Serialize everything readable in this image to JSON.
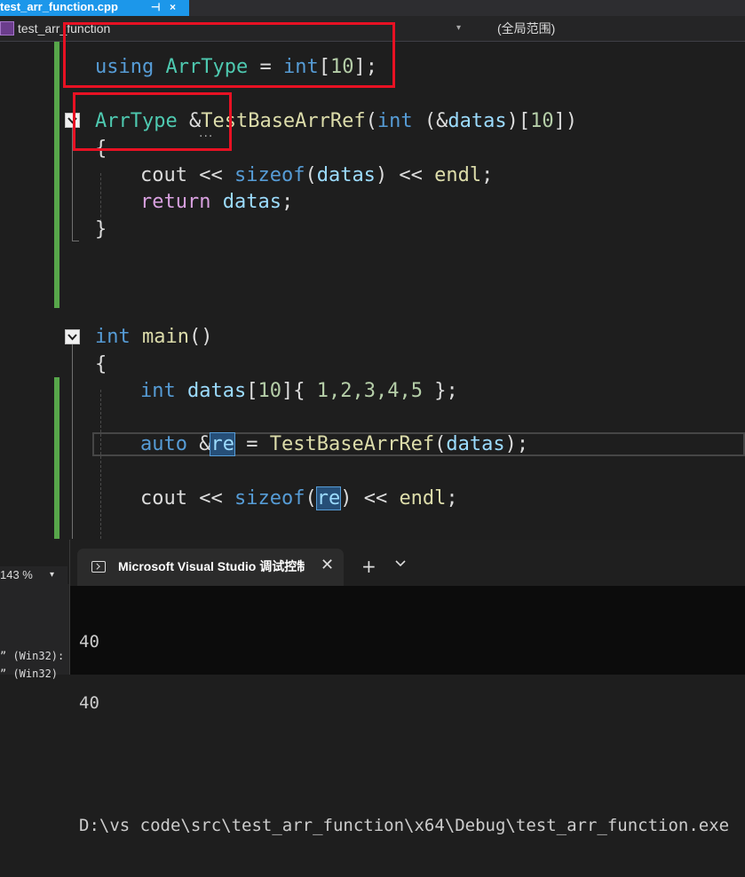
{
  "tab": {
    "filename": "test_arr_function.cpp",
    "pin_icon": "⊣",
    "close_icon": "×"
  },
  "navbar": {
    "scope": "test_arr_function",
    "global_scope": "(全局范围)",
    "dropdown_icon": "▾"
  },
  "code": {
    "line1": {
      "kw": "using",
      "type": "ArrType",
      "eq": " = ",
      "int": "int",
      "br": "[",
      "num": "10",
      "end": "];"
    },
    "line2": {
      "type": "ArrType",
      "amp": " &",
      "fn": "TestBaseArrRef",
      "p1": "(",
      "int": "int",
      "p2": " (&",
      "param": "datas",
      "p3": ")[",
      "num": "10",
      "p4": "])"
    },
    "brace_open": "{",
    "line3": {
      "id": "cout",
      "op1": " << ",
      "fn": "sizeof",
      "p1": "(",
      "param": "datas",
      "p2": ")",
      "op2": " << ",
      "endl": "endl",
      "semi": ";"
    },
    "line4": {
      "kw": "return",
      "sp": " ",
      "param": "datas",
      "semi": ";"
    },
    "brace_close": "}",
    "line5": {
      "int": "int",
      "sp": " ",
      "fn": "main",
      "paren": "()"
    },
    "brace_open2": "{",
    "line6": {
      "int": "int",
      "sp": " ",
      "var": "datas",
      "br": "[",
      "num": "10",
      "rest1": "]{ ",
      "nums": "1,2,3,4,5",
      "rest2": " };"
    },
    "line7": {
      "kw": "auto",
      "amp": " &",
      "var": "re",
      "eq": " = ",
      "fn": "TestBaseArrRef",
      "p1": "(",
      "arg": "datas",
      "p2": ");"
    },
    "line8": {
      "id": "cout",
      "op1": " << ",
      "fn": "sizeof",
      "p1": "(",
      "var": "re",
      "p2": ")",
      "op2": " << ",
      "endl": "endl",
      "semi": ";"
    }
  },
  "status": {
    "zoom": "143 %",
    "zoom_dropdown": "▾",
    "output1": "” (Win32):",
    "output2": "” (Win32)"
  },
  "terminal": {
    "title": "Microsoft Visual Studio 调试控制台",
    "close": "✕",
    "plus": "+",
    "lines": [
      "40",
      "40",
      "",
      "D:\\vs code\\src\\test_arr_function\\x64\\Debug\\test_arr_function.exe"
    ]
  },
  "colors": {
    "highlight_box": "#e81123",
    "tab_accent": "#1c97ea",
    "change_bar": "#57a64a"
  }
}
